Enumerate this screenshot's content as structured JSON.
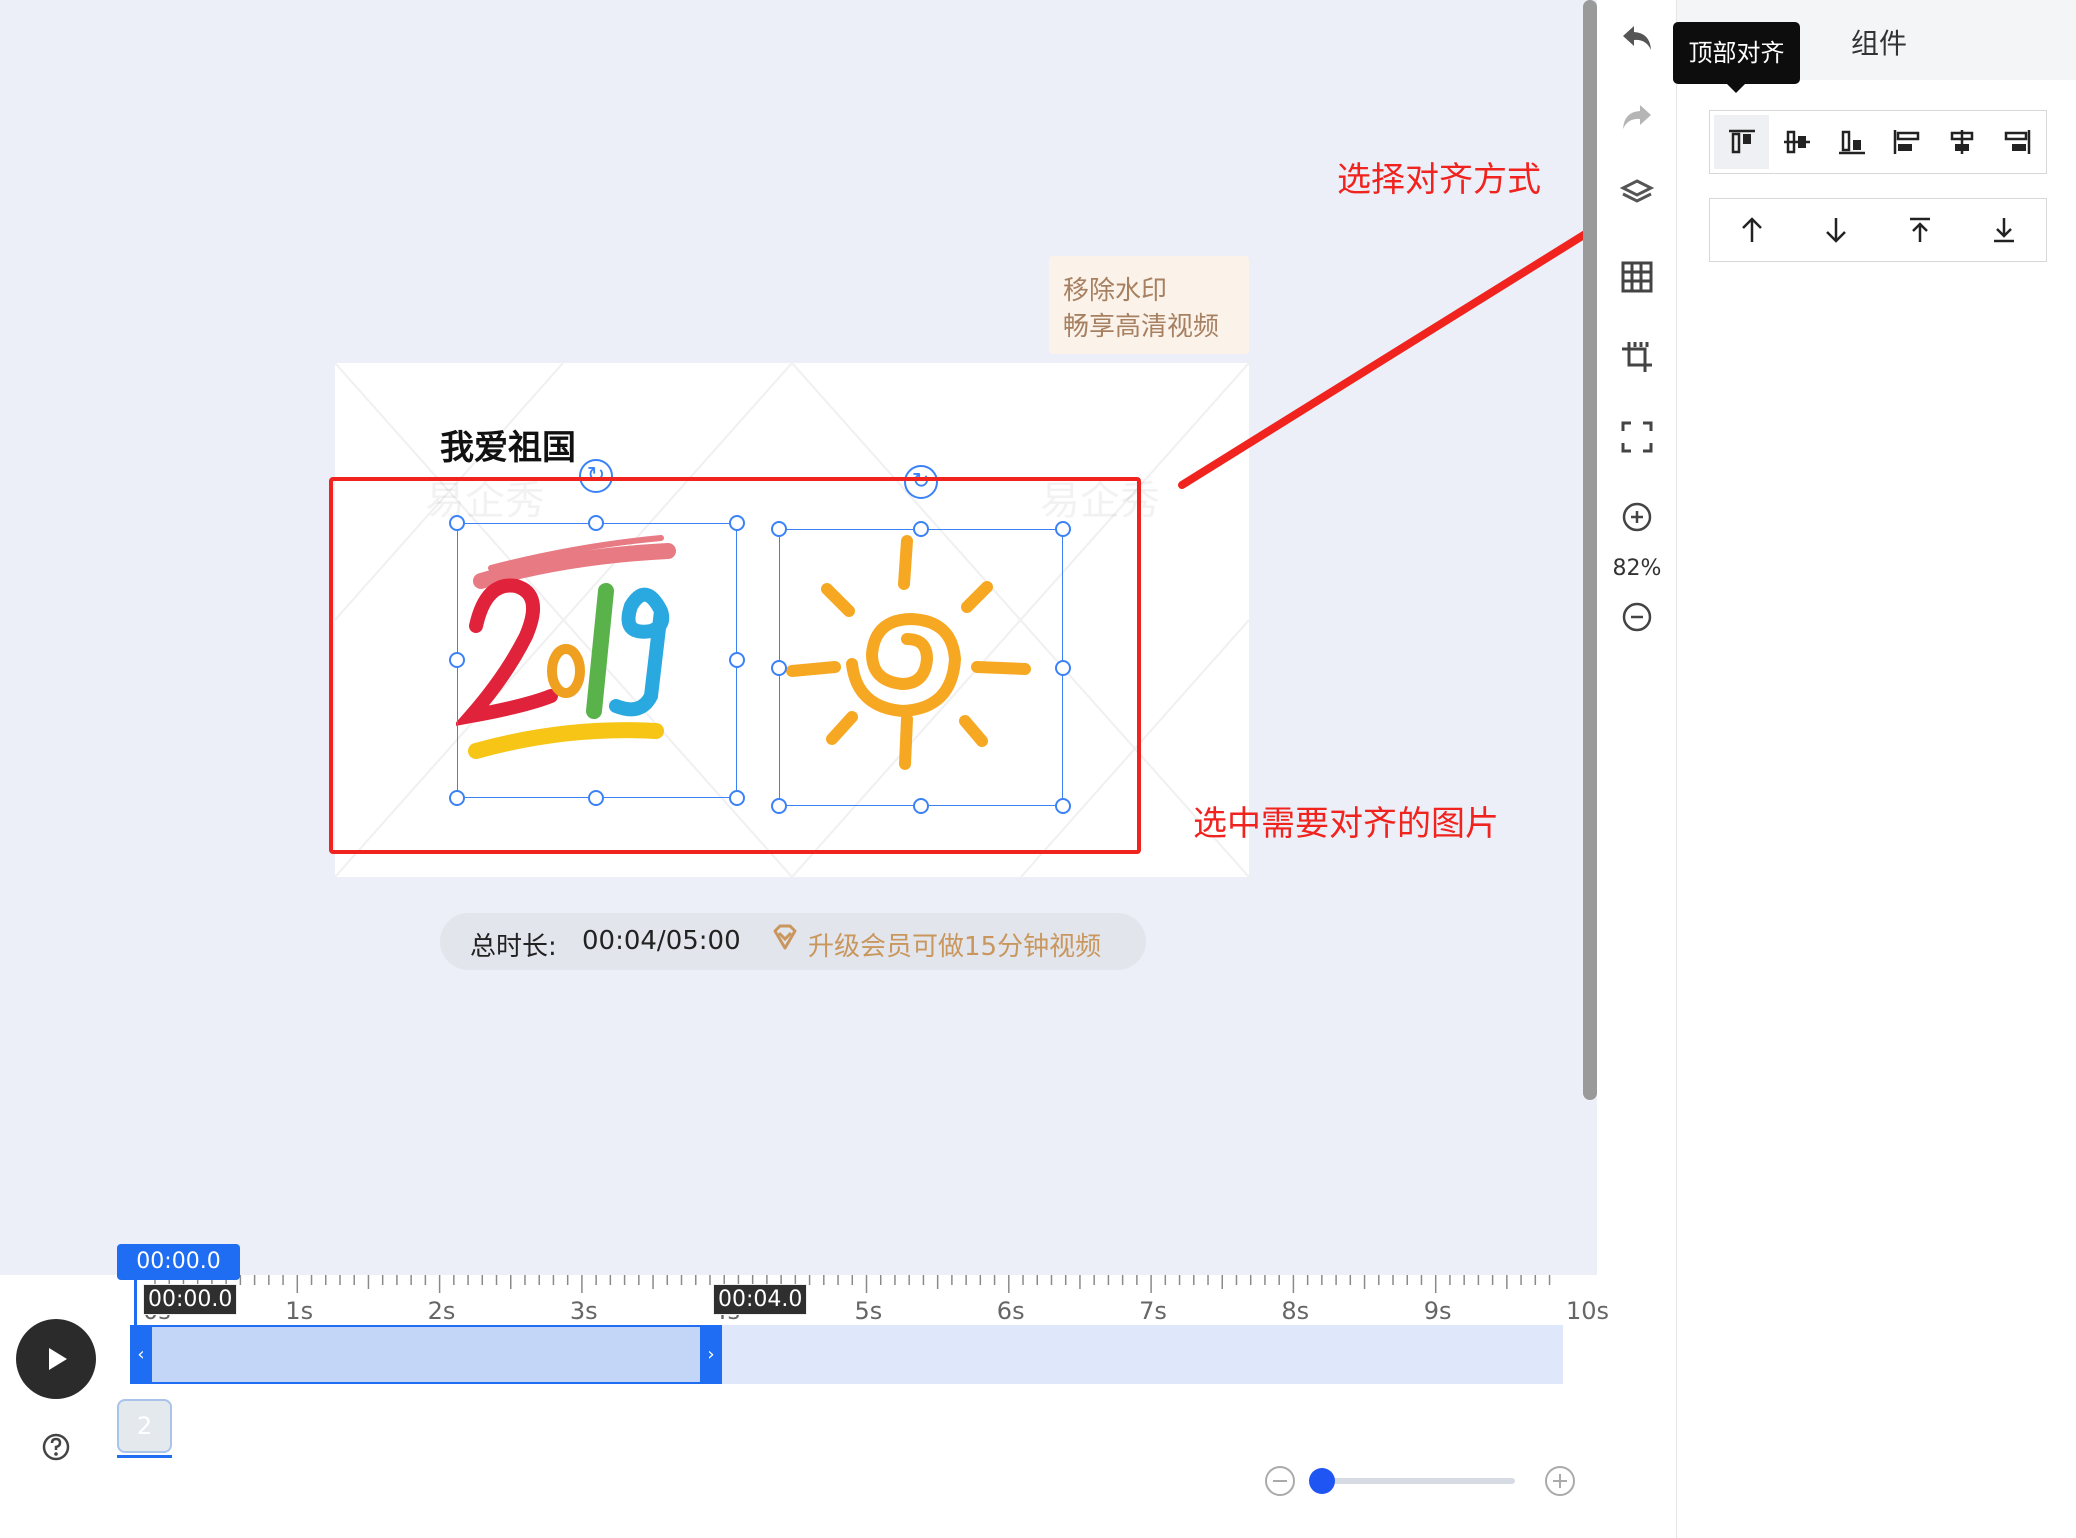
{
  "canvas": {
    "title_text": "我爱祖国",
    "watermark_text": "易企秀",
    "images": [
      {
        "name": "2019-artwork"
      },
      {
        "name": "sun-artwork"
      }
    ]
  },
  "watermark_badge": {
    "line1": "移除水印",
    "line2": "畅享高清视频"
  },
  "duration": {
    "label": "总时长:",
    "value": "00:04/05:00",
    "upgrade_text": "升级会员可做15分钟视频",
    "upgrade_color": "#c9975d"
  },
  "annotations": {
    "choose_align": "选择对齐方式",
    "select_images": "选中需要对齐的图片",
    "color": "#f0231e"
  },
  "toolbar": {
    "zoom": "82%",
    "icons": [
      "undo-icon",
      "redo-icon",
      "layers-icon",
      "grid-icon",
      "crop-icon",
      "fullscreen-icon",
      "zoom-in-icon",
      "zoom-out-icon"
    ]
  },
  "panel": {
    "tab_label": "组件",
    "tooltip": "顶部对齐",
    "align_buttons": [
      "align-top",
      "align-vertical-center",
      "align-bottom",
      "align-left",
      "align-horizontal-center",
      "align-right"
    ],
    "layer_buttons": [
      "move-up",
      "move-down",
      "bring-to-front",
      "send-to-back"
    ]
  },
  "timeline": {
    "playhead": "00:00.0",
    "clip_start": "00:00.0",
    "clip_end": "00:04.0",
    "ticks": [
      "0s",
      "1s",
      "2s",
      "3s",
      "4s",
      "5s",
      "6s",
      "7s",
      "8s",
      "9s",
      "10s"
    ],
    "scene_number": "2",
    "accent": "#1f6df2"
  }
}
